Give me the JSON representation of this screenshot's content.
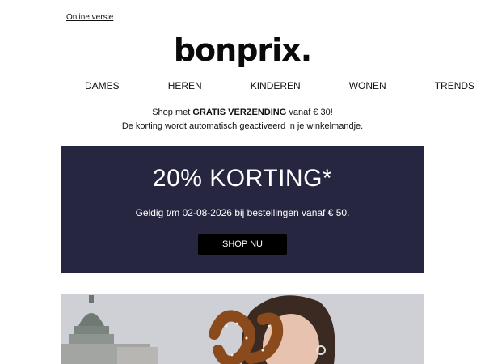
{
  "header": {
    "online_link": "Online versie",
    "logo_text": "bonprix."
  },
  "nav": {
    "items": [
      {
        "label": "DAMES"
      },
      {
        "label": "HEREN"
      },
      {
        "label": "KINDEREN"
      },
      {
        "label": "WONEN"
      },
      {
        "label": "TRENDS"
      }
    ]
  },
  "promo": {
    "line1_prefix": "Shop met ",
    "line1_bold": "GRATIS VERZENDING",
    "line1_suffix": " vanaf € 30!",
    "line2": "De korting wordt automatisch geactiveerd in je winkelmandje."
  },
  "banner": {
    "title": "20% KORTING*",
    "subtitle": "Geldig t/m 02-08-2026 bij bestellingen vanaf € 50.",
    "button_label": "SHOP NU",
    "bg_color": "#272640"
  }
}
